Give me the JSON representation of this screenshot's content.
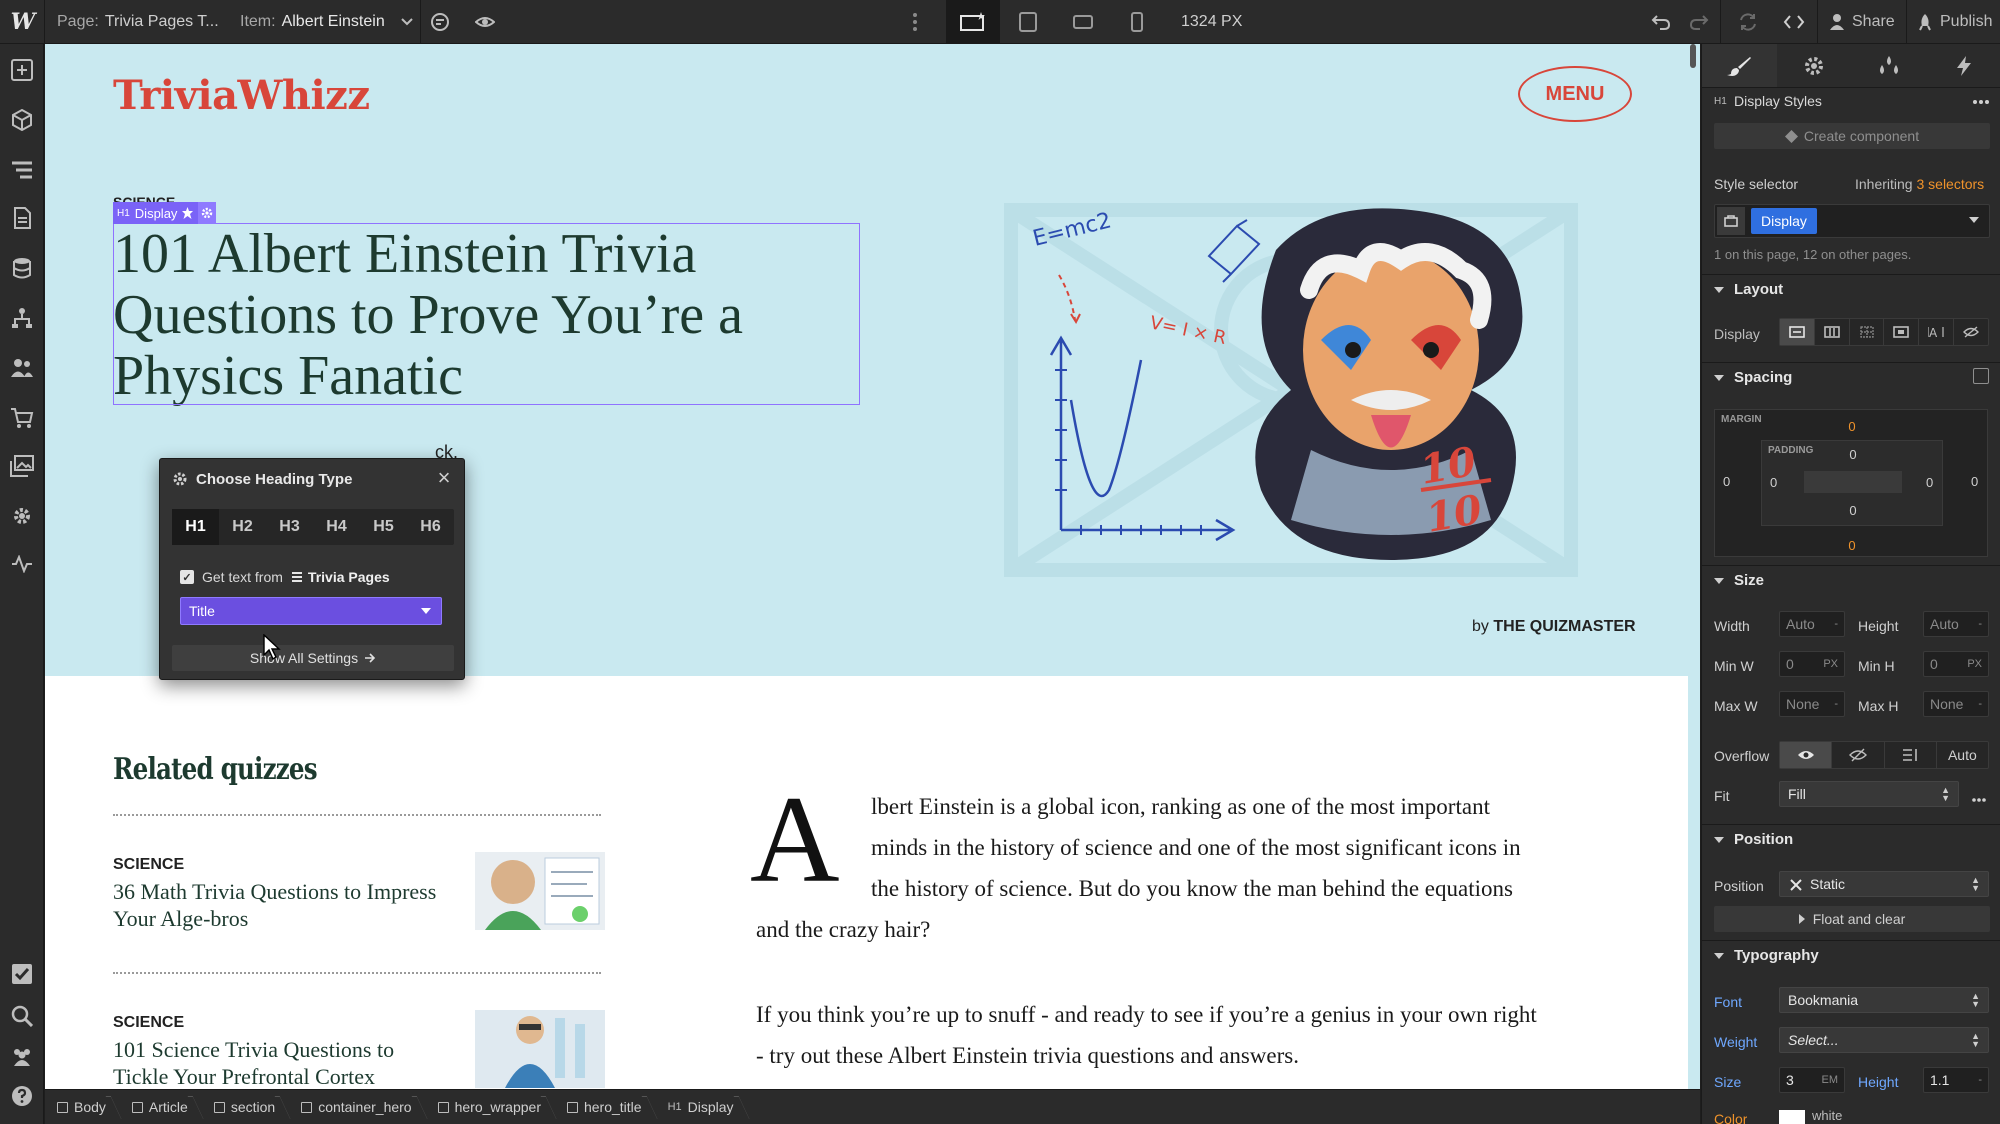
{
  "topbar": {
    "page_label": "Page:",
    "page_name": "Trivia Pages T...",
    "item_label": "Item:",
    "item_name": "Albert Einstein",
    "width_readout": "1324 PX",
    "share_label": "Share",
    "publish_label": "Publish"
  },
  "hero": {
    "brand": "TriviaWhizz",
    "menu_label": "MENU",
    "category": "SCIENCE",
    "title": "101 Albert Einstein Trivia Questions to Prove You’re a Physics Fanatic",
    "subtitle_fragment": "ck.",
    "byline_prefix": "by",
    "byline_author": "THE QUIZMASTER",
    "art_text_emc2": "E=mc2",
    "art_text_vir": "V= I × R",
    "art_score_top": "10",
    "art_score_bottom": "10"
  },
  "selection": {
    "tag_label": "Display",
    "tag_prefix": "H1"
  },
  "heading_popup": {
    "title": "Choose Heading Type",
    "tabs": [
      "H1",
      "H2",
      "H3",
      "H4",
      "H5",
      "H6"
    ],
    "active_tab": "H1",
    "checkbox_label": "Get text from",
    "source_name": "Trivia Pages",
    "field_value": "Title",
    "settings_button": "Show All Settings"
  },
  "related": {
    "heading": "Related quizzes",
    "items": [
      {
        "category": "SCIENCE",
        "title": "36 Math Trivia Questions to Impress Your Alge-bros"
      },
      {
        "category": "SCIENCE",
        "title": "101 Science Trivia Questions to Tickle Your Prefrontal Cortex"
      }
    ]
  },
  "article": {
    "dropcap": "A",
    "para1_lines": [
      "lbert Einstein is a global icon, ranking as one of the most important",
      "minds in the history of science and one of the most significant icons in",
      "the history of science. But do you know the man behind the equations"
    ],
    "para1_last": "and the crazy hair?",
    "para2_lines": [
      "If you think you’re up to snuff - and ready to see if you’re a genius in your own right",
      "- try out these Albert Einstein trivia questions and answers."
    ]
  },
  "breadcrumbs": [
    {
      "label": "Body",
      "icon": "square"
    },
    {
      "label": "Article",
      "icon": "square"
    },
    {
      "label": "section",
      "icon": "square"
    },
    {
      "label": "container_hero",
      "icon": "square"
    },
    {
      "label": "hero_wrapper",
      "icon": "square"
    },
    {
      "label": "hero_title",
      "icon": "square"
    },
    {
      "label": "Display",
      "icon": "h1"
    }
  ],
  "panel": {
    "element_tag": "H1",
    "element_name": "Display Styles",
    "create_component": "Create component",
    "style_selector_label": "Style selector",
    "inheriting_prefix": "Inheriting",
    "inheriting_count": "3 selectors",
    "selector_chip": "Display",
    "usage_note": "1 on this page, 12 on other pages.",
    "sections": {
      "layout": "Layout",
      "spacing": "Spacing",
      "size": "Size",
      "position": "Position",
      "typography": "Typography"
    },
    "display_label": "Display",
    "margin_label": "MARGIN",
    "padding_label": "PADDING",
    "margin": {
      "top": "0",
      "right": "0",
      "bottom": "0",
      "left": "0"
    },
    "padding": {
      "top": "0",
      "right": "0",
      "bottom": "0",
      "left": "0"
    },
    "size": {
      "width_label": "Width",
      "width_value": "Auto",
      "height_label": "Height",
      "height_value": "Auto",
      "minw_label": "Min W",
      "minw_value": "0",
      "minw_unit": "PX",
      "minh_label": "Min H",
      "minh_value": "0",
      "minh_unit": "PX",
      "maxw_label": "Max W",
      "maxw_value": "None",
      "maxh_label": "Max H",
      "maxh_value": "None",
      "overflow_label": "Overflow",
      "overflow_auto": "Auto",
      "fit_label": "Fit",
      "fit_value": "Fill"
    },
    "position": {
      "label": "Position",
      "value": "Static",
      "float_clear": "Float and clear"
    },
    "typography": {
      "font_label": "Font",
      "font_value": "Bookmania",
      "weight_label": "Weight",
      "weight_value": "Select...",
      "size_label": "Size",
      "size_value": "3",
      "size_unit": "EM",
      "height_label": "Height",
      "height_value": "1.1",
      "color_label": "Color",
      "color_value": "white"
    }
  },
  "colors": {
    "hero_bg": "#c9e9f0",
    "brand_red": "#d8463a",
    "selection_purple": "#7a63f7",
    "heading_green": "#1d3a2f",
    "panel_bg": "#2b2b2b",
    "accent_blue": "#6fa8ff",
    "inherit_orange": "#f0932b"
  }
}
